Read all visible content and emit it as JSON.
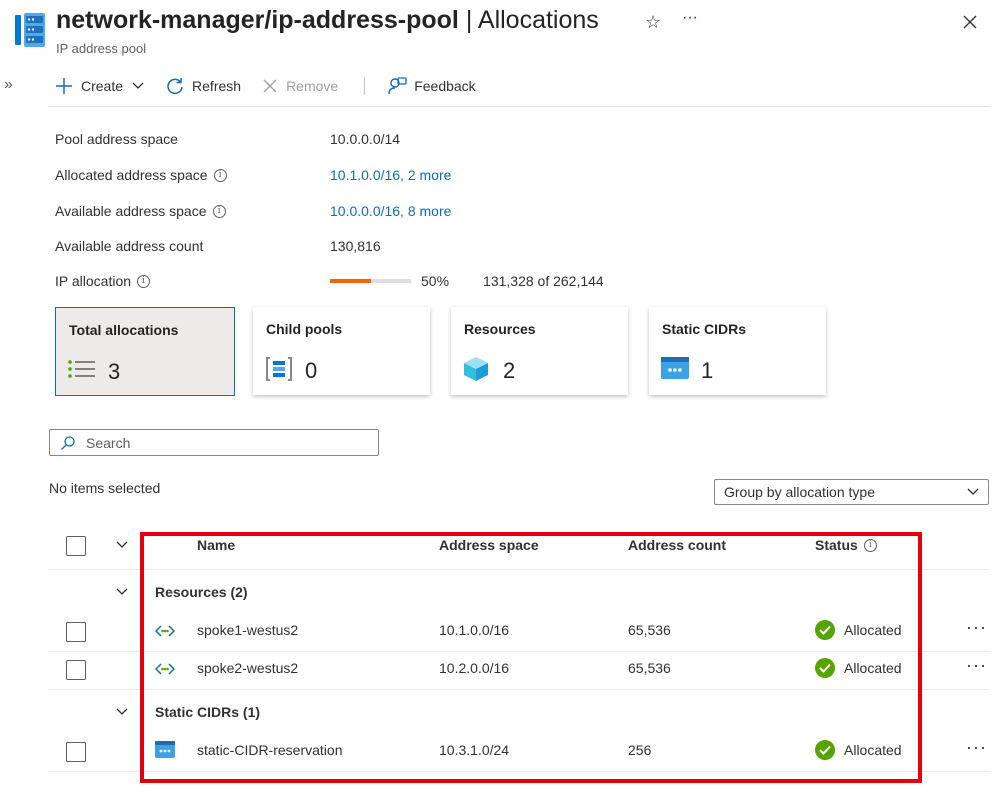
{
  "header": {
    "title_resource": "network-manager/ip-address-pool",
    "title_separator": "|",
    "title_page": "Allocations",
    "subtitle": "IP address pool",
    "expand_glyph": "»"
  },
  "toolbar": {
    "create": "Create",
    "refresh": "Refresh",
    "remove": "Remove",
    "feedback": "Feedback"
  },
  "essentials": [
    {
      "label": "Pool address space",
      "value": "10.0.0.0/14",
      "info": false,
      "link": false
    },
    {
      "label": "Allocated address space",
      "value": "10.1.0.0/16, 2 more",
      "info": true,
      "link": true
    },
    {
      "label": "Available address space",
      "value": "10.0.0.0/16, 8 more",
      "info": true,
      "link": true
    },
    {
      "label": "Available address count",
      "value": "130,816",
      "info": false,
      "link": false
    }
  ],
  "ip_allocation": {
    "label": "IP allocation",
    "percent_label": "50%",
    "fraction": 0.5,
    "detail": "131,328 of 262,144"
  },
  "cards": [
    {
      "title": "Total allocations",
      "value": "3",
      "icon": "list-icon"
    },
    {
      "title": "Child pools",
      "value": "0",
      "icon": "child-pool-icon"
    },
    {
      "title": "Resources",
      "value": "2",
      "icon": "resource-cube-icon"
    },
    {
      "title": "Static CIDRs",
      "value": "1",
      "icon": "static-cidr-icon"
    }
  ],
  "search": {
    "placeholder": "Search"
  },
  "selection_status": "No items selected",
  "group_by": {
    "selected": "Group by allocation type"
  },
  "table": {
    "columns": {
      "name": "Name",
      "address_space": "Address space",
      "address_count": "Address count",
      "status": "Status"
    },
    "groups": [
      {
        "label": "Resources (2)",
        "rows": [
          {
            "name": "spoke1-westus2",
            "address_space": "10.1.0.0/16",
            "address_count": "65,536",
            "status": "Allocated",
            "icon": "vnet-icon"
          },
          {
            "name": "spoke2-westus2",
            "address_space": "10.2.0.0/16",
            "address_count": "65,536",
            "status": "Allocated",
            "icon": "vnet-icon"
          }
        ]
      },
      {
        "label": "Static CIDRs (1)",
        "rows": [
          {
            "name": "static-CIDR-reservation",
            "address_space": "10.3.1.0/24",
            "address_count": "256",
            "status": "Allocated",
            "icon": "static-cidr-icon"
          }
        ]
      }
    ]
  },
  "colors": {
    "accent": "#0f6cbd",
    "progress": "#f7630c",
    "success": "#57a300",
    "highlight": "#e3000f"
  }
}
